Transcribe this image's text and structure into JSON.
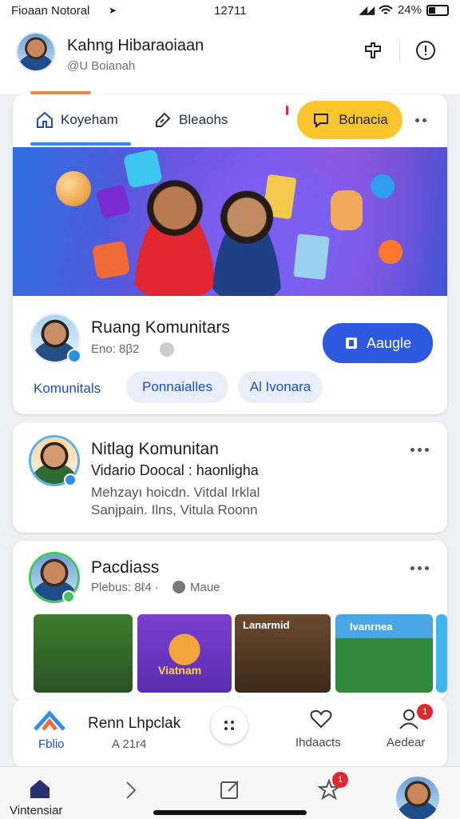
{
  "status": {
    "carrier": "Fioaan Notoral",
    "time": "12711",
    "battery": "24%"
  },
  "header": {
    "name": "Kahng Hibaraoiaan",
    "handle": "@U Boianah"
  },
  "tabs": [
    {
      "label": "Koyeham",
      "icon": "home-icon"
    },
    {
      "label": "Bleaohs",
      "icon": "tag-icon"
    },
    {
      "label": "Bdnacia",
      "icon": "chat-bubble-icon"
    }
  ],
  "community": {
    "title": "Ruang Komunitars",
    "meta": "Eno: 8β2",
    "join_label": "Aaugle",
    "chips": [
      "Komunitals",
      "Ponnaialles",
      "Al Ivonara"
    ]
  },
  "post1": {
    "title": "Nitlag Komunitan",
    "line1": "Vidario  Doocal : haonligha",
    "line2": "Mehzayı hoicdn. Vitdal Irklal",
    "line3": "Sanjpain. Ilns, Vitula Roonn"
  },
  "post2": {
    "title": "Pacdiass",
    "meta": "Plebus: 8ℓ4 ·",
    "meta2": "Maue"
  },
  "thumbs": [
    {
      "label": "",
      "color": "#3a6b2e"
    },
    {
      "label": "Viatnam",
      "color": "#6b3fc9"
    },
    {
      "label": "Lanarmid",
      "color": "#5a3a22"
    },
    {
      "label": "Ivanrnea",
      "color": "#2f8a3c"
    }
  ],
  "dock": {
    "item1": "Fblio",
    "item2_title": "Renn Lhpclak",
    "item2_sub": "A 21r4",
    "item3": "Ihdaacts",
    "item4": "Aedear",
    "badge": "1"
  },
  "bottom_nav": {
    "home_label": "Vintensiar",
    "badge": "1"
  }
}
